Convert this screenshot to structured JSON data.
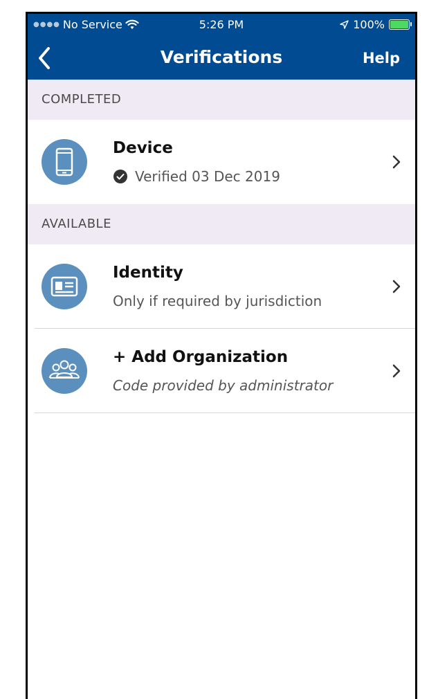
{
  "status_bar": {
    "carrier": "No Service",
    "time": "5:26 PM",
    "battery": "100%"
  },
  "navbar": {
    "title": "Verifications",
    "help_label": "Help"
  },
  "sections": {
    "completed_label": "COMPLETED",
    "available_label": "AVAILABLE"
  },
  "items": {
    "device": {
      "title": "Device",
      "subtitle": "Verified 03 Dec 2019",
      "icon": "phone-icon"
    },
    "identity": {
      "title": "Identity",
      "subtitle": "Only if required by jurisdiction",
      "icon": "id-card-icon"
    },
    "organization": {
      "title": "+ Add Organization",
      "subtitle": "Code provided by administrator",
      "icon": "group-icon"
    }
  },
  "colors": {
    "header_bg": "#004b91",
    "section_bg": "#efeaf4",
    "icon_circle": "#5b8fbe"
  }
}
